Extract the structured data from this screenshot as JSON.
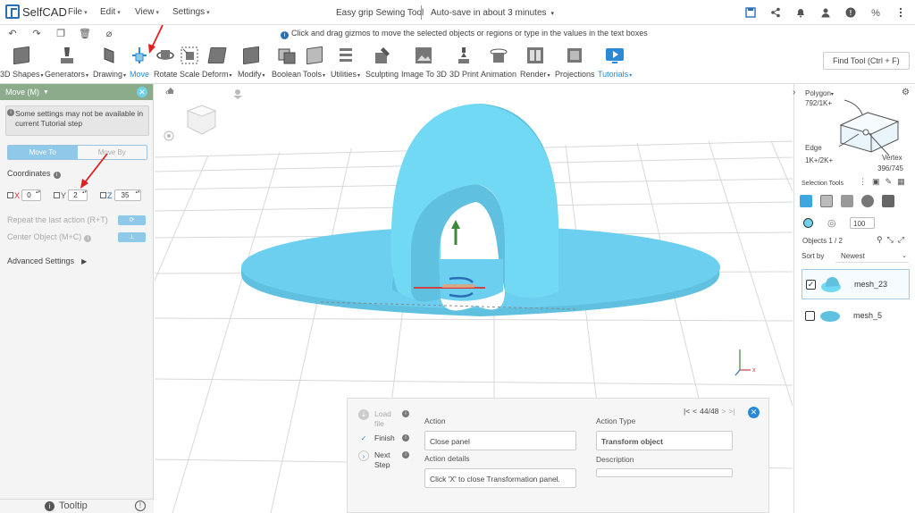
{
  "app": {
    "brand": "SelfCAD",
    "menus": [
      "File",
      "Edit",
      "View",
      "Settings"
    ],
    "project_title": "Easy grip Sewing Tool",
    "autosave": "Auto-save in about 3 minutes",
    "hint": "Click and drag gizmos to move the selected objects or regions or type in the values in the text boxes"
  },
  "toolbar": {
    "tools": [
      {
        "label": "3D Shapes",
        "dropdown": true
      },
      {
        "label": "Generators",
        "dropdown": true
      },
      {
        "label": "Drawing",
        "dropdown": true
      },
      {
        "label": "Move",
        "dropdown": false
      },
      {
        "label": "Rotate",
        "dropdown": false
      },
      {
        "label": "Scale",
        "dropdown": false
      },
      {
        "label": "Deform",
        "dropdown": true
      },
      {
        "label": "Modify",
        "dropdown": true
      },
      {
        "label": "Boolean",
        "dropdown": false
      },
      {
        "label": "Tools",
        "dropdown": true
      },
      {
        "label": "Utilities",
        "dropdown": true
      },
      {
        "label": "Sculpting",
        "dropdown": false
      },
      {
        "label": "Image To 3D",
        "dropdown": false
      },
      {
        "label": "3D Print",
        "dropdown": false
      },
      {
        "label": "Animation",
        "dropdown": false
      },
      {
        "label": "Render",
        "dropdown": true
      },
      {
        "label": "Projections",
        "dropdown": false
      },
      {
        "label": "Tutorials",
        "dropdown": true
      }
    ],
    "find_tool": "Find Tool (Ctrl + F)"
  },
  "move_panel": {
    "title": "Move (M)",
    "warning": "Some settings may not be available in current Tutorial step",
    "move_to": "Move To",
    "move_by": "Move By",
    "coordinates_label": "Coordinates",
    "x_label": "X",
    "y_label": "Y",
    "z_label": "Z",
    "x_value": "0",
    "y_value": "2",
    "z_value": "35",
    "repeat_label": "Repeat the last action (R+T)",
    "center_label": "Center Object (M+C)",
    "advanced": "Advanced Settings",
    "tooltip": "Tooltip"
  },
  "right_panel": {
    "polygon_label": "Polygon",
    "polygon_count": "792/1K+",
    "edge_label": "Edge",
    "edge_count": "1K+/2K+",
    "vertex_label": "Vertex",
    "vertex_count": "396/745",
    "selection_tools": "Selection Tools",
    "size_value": "100",
    "objects_label": "Objects 1 / 2",
    "sort_label": "Sort by",
    "sort_value": "Newest",
    "objects": [
      {
        "name": "mesh_23",
        "checked": true
      },
      {
        "name": "mesh_5",
        "checked": false
      }
    ]
  },
  "action_panel": {
    "steps": [
      "Load file",
      "Finish",
      "Next Step"
    ],
    "nav": "44/48",
    "action_label": "Action",
    "action_value": "Close panel",
    "action_type_label": "Action Type",
    "action_type_value": "Transform object",
    "details_label": "Action details",
    "details_value": "Click 'X' to close Transformation panel.",
    "description_label": "Description",
    "description_value": ""
  },
  "colors": {
    "accent": "#2a8ad5",
    "object_blue": "#72d9f5",
    "panel_header": "#8bab8b",
    "annotation_red": "#e02020"
  }
}
